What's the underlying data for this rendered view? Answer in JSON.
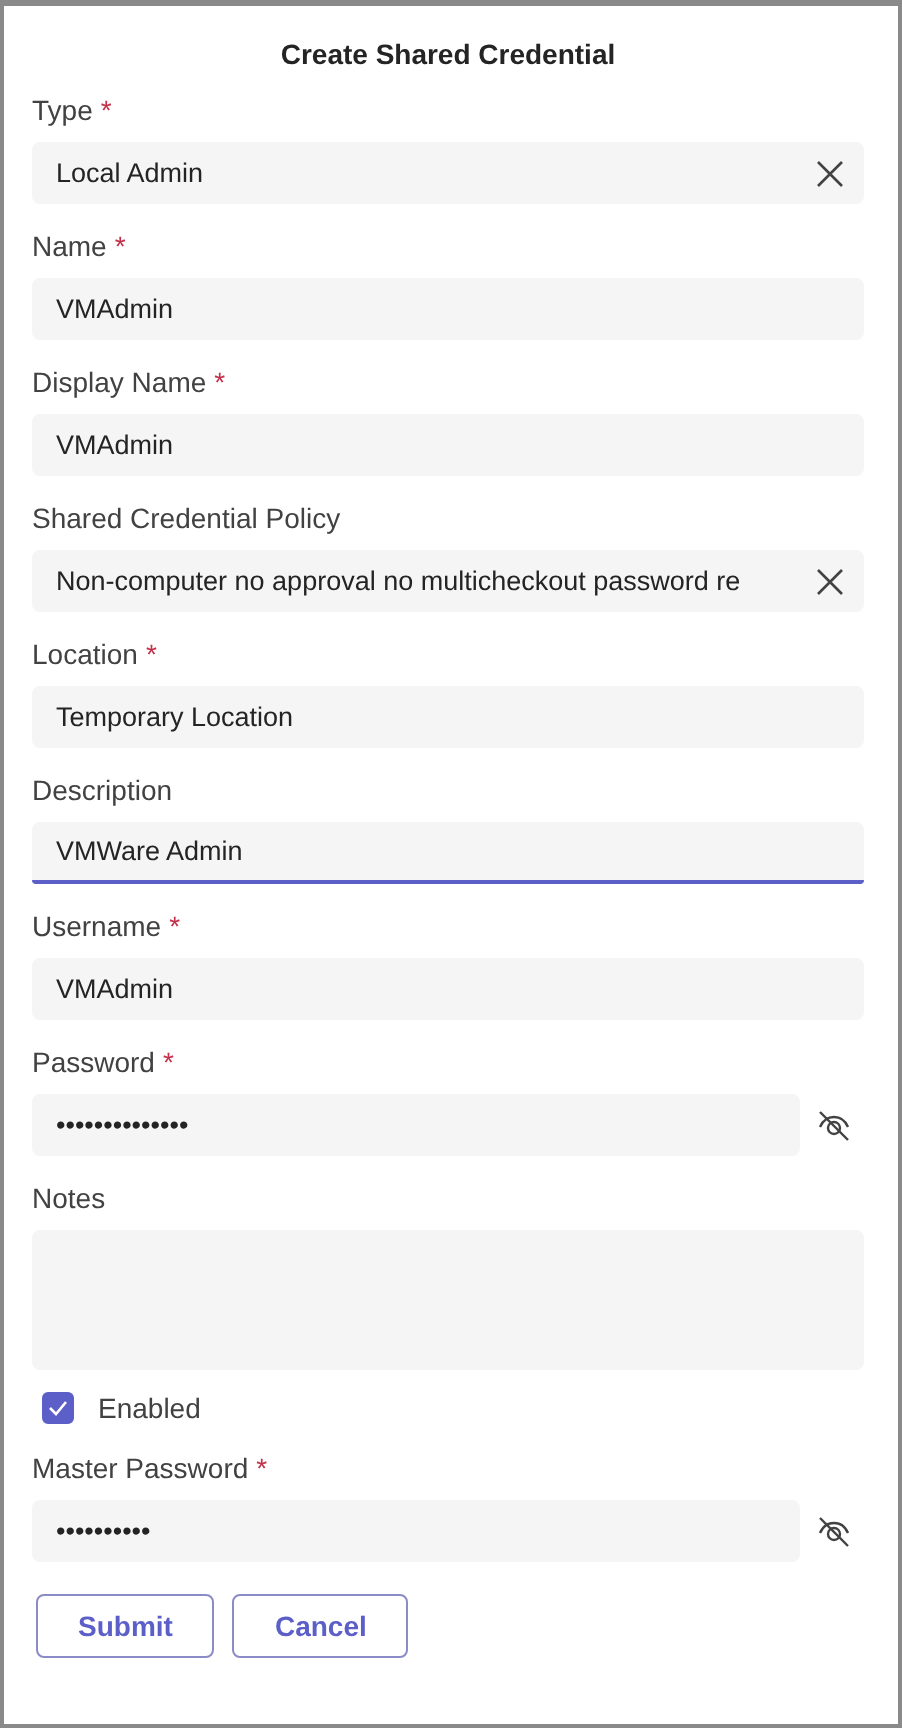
{
  "dialog": {
    "title": "Create Shared Credential"
  },
  "fields": [
    {
      "kind": "select",
      "label": "Type",
      "required_mark": "*",
      "value": "Local Admin",
      "focused": false
    },
    {
      "kind": "text",
      "label": "Name",
      "required_mark": "*",
      "value": "VMAdmin",
      "focused": false
    },
    {
      "kind": "text",
      "label": "Display Name",
      "required_mark": "*",
      "value": "VMAdmin",
      "focused": false
    },
    {
      "kind": "select",
      "label": "Shared Credential Policy",
      "value": "Non-computer no approval no multicheckout password re",
      "focused": false
    },
    {
      "kind": "text",
      "label": "Location",
      "required_mark": "*",
      "value": "Temporary Location",
      "focused": false
    },
    {
      "kind": "text",
      "label": "Description",
      "value": "VMWare Admin",
      "focused": true
    },
    {
      "kind": "text",
      "label": "Username",
      "required_mark": "*",
      "value": "VMAdmin",
      "focused": false
    },
    {
      "kind": "password",
      "label": "Password",
      "required_mark": "*",
      "value": "••••••••••••••",
      "focused": false
    },
    {
      "kind": "textarea",
      "label": "Notes",
      "focused": false
    },
    {
      "kind": "checkbox",
      "label": "Enabled",
      "checked": true
    },
    {
      "kind": "password",
      "label": "Master Password",
      "required_mark": "*",
      "value": "••••••••••",
      "focused": false
    }
  ],
  "buttons": [
    "Submit",
    "Cancel"
  ]
}
